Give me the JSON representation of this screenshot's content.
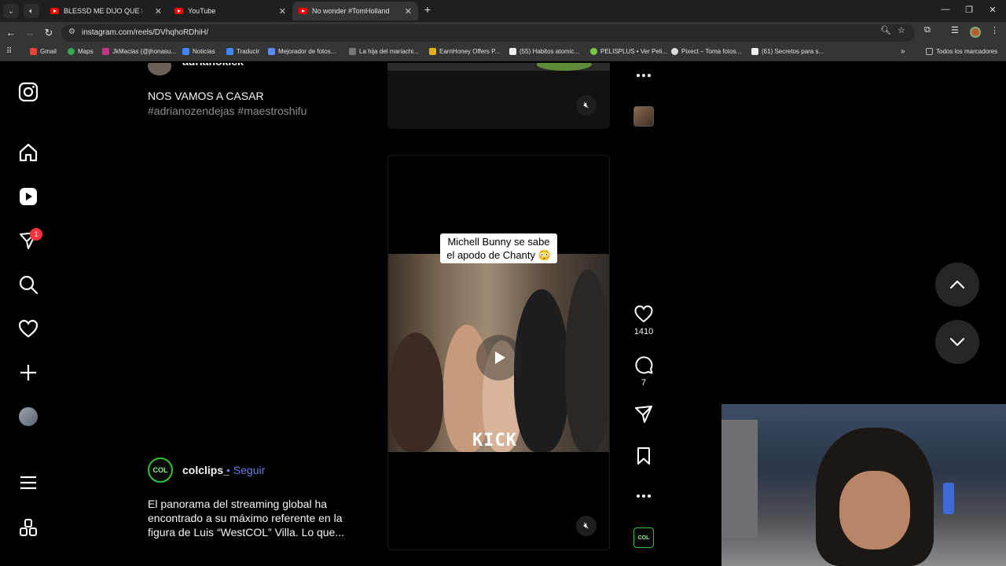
{
  "browser": {
    "tabs": [
      {
        "title": "BLESSD ME DIJO QUE LE PI",
        "active": false
      },
      {
        "title": "YouTube",
        "active": false
      },
      {
        "title": "No wonder #TomHolland didn",
        "active": true
      }
    ],
    "url": "instagram.com/reels/DVhqhoRDhiH/",
    "bookmarks": [
      "Gmail",
      "Maps",
      "JkMacias (@jhonasu...",
      "Noticias",
      "Traducir",
      "Mejorador de fotos...",
      "La hija del mariachi...",
      "EarnHoney Offers P...",
      "(55) Habitos atomic...",
      "PELISPLUS • Ver Peli...",
      "Pixect – Toma fotos...",
      "(61) Secretos para s..."
    ],
    "all_bookmarks_label": "Todos los marcadores"
  },
  "sidebar": {
    "notification_count": "1"
  },
  "post_prev": {
    "author": "adrianokick",
    "caption": "NOS VAMOS A CASAR",
    "tags": "#adrianozendejas #maestroshifu"
  },
  "post": {
    "overlay_text": "Michell Bunny se sabe el apodo de Chanty 😳",
    "watermark": "KICK",
    "likes": "1410",
    "comments": "7",
    "author": "colclips_",
    "follow_label": "• Seguir",
    "avatar_text": "COL",
    "caption": "El panorama del streaming global ha encontrado a su máximo referente en la figura de Luis “WestCOL” Villa. Lo que..."
  },
  "colors": {
    "accent_link": "#6b7fe0",
    "badge": "#ff3040",
    "background": "#000000"
  }
}
